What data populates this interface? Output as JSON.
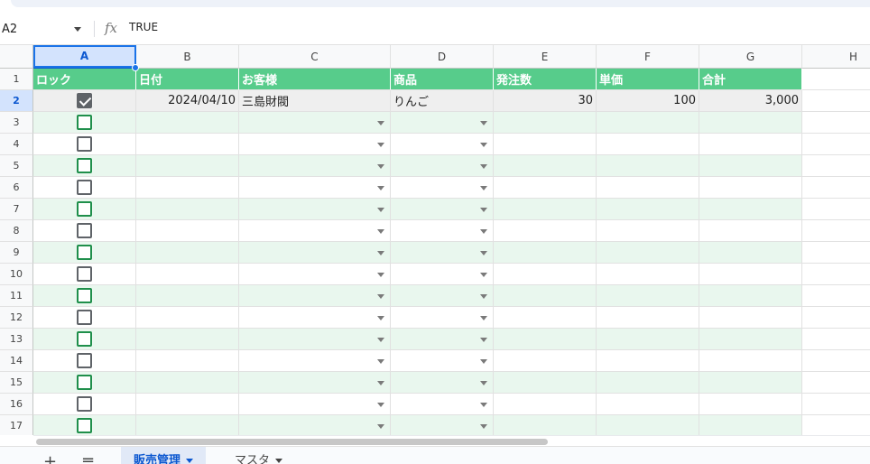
{
  "formula_bar": {
    "name_box": "A2",
    "fx": "fx",
    "value": "TRUE"
  },
  "columns": [
    "A",
    "B",
    "C",
    "D",
    "E",
    "F",
    "G",
    "H"
  ],
  "row_numbers": [
    "1",
    "2",
    "3",
    "4",
    "5",
    "6",
    "7",
    "8",
    "9",
    "10",
    "11",
    "12",
    "13",
    "14",
    "15",
    "16",
    "17"
  ],
  "header_row": [
    "ロック",
    "日付",
    "お客様",
    "商品",
    "発注数",
    "単価",
    "合計"
  ],
  "data_row": {
    "locked": true,
    "date": "2024/04/10",
    "customer": "三島財閥",
    "product": "りんご",
    "quantity": "30",
    "unit_price": "100",
    "total": "3,000"
  },
  "sheet_tabs": [
    {
      "label": "販売管理",
      "active": true
    },
    {
      "label": "マスタ",
      "active": false
    }
  ],
  "sheet_buttons": {
    "add": "+",
    "list": "≡"
  },
  "colors": {
    "header_green": "#57cc8b",
    "alt_row": "#e9f7ee",
    "selection": "#1a73e8"
  }
}
